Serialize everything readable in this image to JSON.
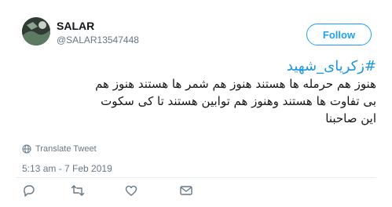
{
  "user": {
    "display_name": "SALAR",
    "handle": "@SALAR13547448"
  },
  "follow_label": "Follow",
  "tweet": {
    "hashtag": "#زکریای_شهید",
    "lines": [
      "هنوز هم حرمله ها هستند هنوز هم شمر ها هستند هنوز هم",
      "بی تفاوت ها هستند وهنوز هم توابین هستند تا کی سکوت",
      "این صاحبنا"
    ]
  },
  "translate_label": "Translate Tweet",
  "timestamp": "5:13 am - 7 Feb 2019",
  "colors": {
    "accent": "#1da1f2",
    "hashtag": "#1b95e0",
    "muted": "#657786"
  },
  "icons": {
    "reply": "reply-icon",
    "retweet": "retweet-icon",
    "like": "heart-icon",
    "message": "envelope-icon",
    "menu": "chevron-down-icon",
    "translate": "globe-icon"
  }
}
